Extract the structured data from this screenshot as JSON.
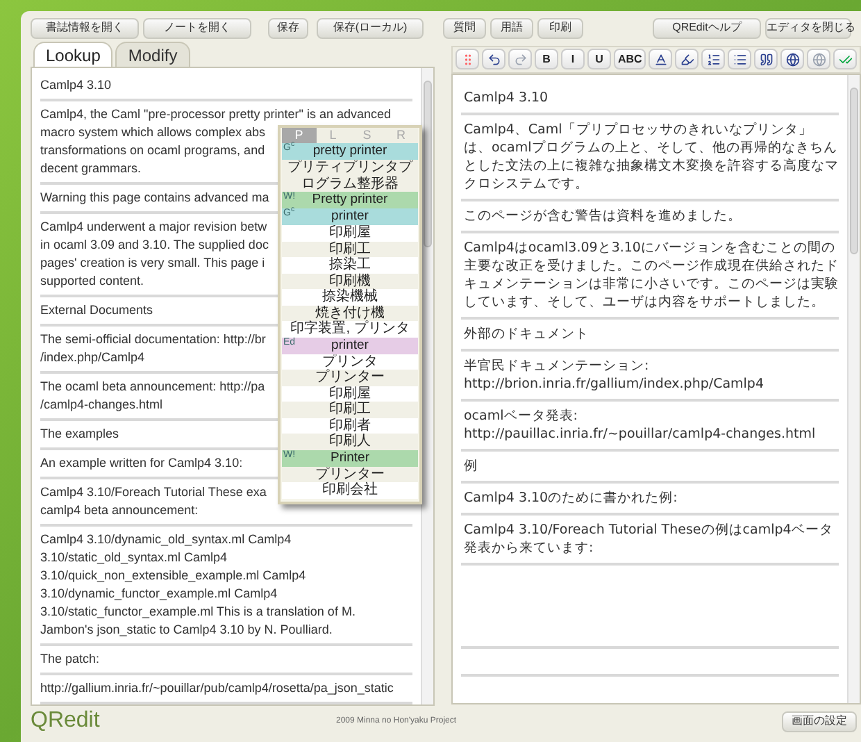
{
  "toolbar": [
    {
      "label": "書誌情報を開く"
    },
    {
      "label": "ノートを開く"
    },
    {
      "label": "保存"
    },
    {
      "label": "保存(ローカル)"
    },
    {
      "label": "質問"
    },
    {
      "label": "用語"
    },
    {
      "label": "印刷"
    },
    {
      "label": "QREditヘルプ"
    },
    {
      "label": "エディタを閉じる"
    }
  ],
  "left_panel": {
    "tabs": [
      {
        "label": "Lookup",
        "selected": true
      },
      {
        "label": "Modify",
        "selected": false
      }
    ],
    "paragraphs": [
      {
        "lines": [
          "Camlp4 3.10"
        ]
      },
      {
        "lines": [
          "Camlp4, the Caml \"pre-processor pretty printer\" is an advanced",
          "macro system which allows complex abs",
          "transformations on ocaml programs, and",
          "decent grammars."
        ]
      },
      {
        "lines": [
          "Warning this page contains advanced ma"
        ]
      },
      {
        "lines": [
          "Camlp4 underwent a major revision betw",
          "in ocaml 3.09 and 3.10. The supplied doc",
          "pages' creation is very small. This page i",
          "supported content."
        ]
      },
      {
        "lines": [
          "External Documents"
        ]
      },
      {
        "lines": [
          "The semi-official documentation: http://br",
          "/index.php/Camlp4"
        ]
      },
      {
        "lines": [
          "The ocaml beta announcement: http://pa",
          "/camlp4-changes.html"
        ]
      },
      {
        "lines": [
          "The examples"
        ]
      },
      {
        "lines": [
          "An example written for Camlp4 3.10:"
        ]
      },
      {
        "lines": [
          "Camlp4 3.10/Foreach Tutorial These exa",
          "camlp4 beta announcement:"
        ]
      },
      {
        "lines": [
          "Camlp4 3.10/dynamic_old_syntax.ml Camlp4",
          "3.10/static_old_syntax.ml Camlp4",
          "3.10/quick_non_extensible_example.ml Camlp4",
          "3.10/dynamic_functor_example.ml Camlp4",
          "3.10/static_functor_example.ml This is a translation of M.",
          "Jambon's json_static to Camlp4 3.10 by N. Poulliard."
        ]
      },
      {
        "lines": [
          "The patch:"
        ]
      },
      {
        "lines": [
          "http://gallium.inria.fr/~pouillar/pub/camlp4/rosetta/pa_json_static"
        ]
      }
    ],
    "popup": {
      "tabs": [
        {
          "label": "P",
          "selected": true
        },
        {
          "label": "L",
          "selected": false
        },
        {
          "label": "S",
          "selected": false
        },
        {
          "label": "R",
          "selected": false
        }
      ],
      "rows": [
        {
          "kind": "header",
          "source": "G$^{c}$",
          "text": "pretty printer",
          "color": "#a9dcdc"
        },
        {
          "kind": "entry",
          "text": "プリティプリンタプログラム整形器"
        },
        {
          "kind": "header",
          "source": "W!",
          "text": "Pretty printer",
          "color": "#acd9ac"
        },
        {
          "kind": "header",
          "source": "G$^{c}$",
          "text": "printer",
          "color": "#a9dcdc"
        },
        {
          "kind": "entry",
          "text": "印刷屋"
        },
        {
          "kind": "entry",
          "text": "印刷工"
        },
        {
          "kind": "entry",
          "text": "捺染工"
        },
        {
          "kind": "entry",
          "text": "印刷機"
        },
        {
          "kind": "entry",
          "text": "捺染機械"
        },
        {
          "kind": "entry",
          "text": "焼き付け機"
        },
        {
          "kind": "entry",
          "text": "印字装置, プリンタ"
        },
        {
          "kind": "header",
          "source": "Ed",
          "text": "printer",
          "color": "#e6cce6"
        },
        {
          "kind": "entry",
          "text": "プリンタ"
        },
        {
          "kind": "entry",
          "text": "プリンター"
        },
        {
          "kind": "entry",
          "text": "印刷屋"
        },
        {
          "kind": "entry",
          "text": "印刷工"
        },
        {
          "kind": "entry",
          "text": "印刷者"
        },
        {
          "kind": "entry",
          "text": "印刷人"
        },
        {
          "kind": "header",
          "source": "W!",
          "text": "Printer",
          "color": "#acd9ac"
        },
        {
          "kind": "entry",
          "text": "プリンター"
        },
        {
          "kind": "entry",
          "text": "印刷会社"
        }
      ]
    }
  },
  "editor": {
    "tools": [
      {
        "kind": "handle",
        "disabled": false
      },
      {
        "kind": "undo",
        "disabled": false
      },
      {
        "kind": "redo",
        "disabled": true
      },
      {
        "kind": "text",
        "label": "B",
        "disabled": false
      },
      {
        "kind": "text",
        "label": "I",
        "disabled": false
      },
      {
        "kind": "text",
        "label": "U",
        "disabled": false
      },
      {
        "kind": "text",
        "label": "ABC",
        "disabled": false
      },
      {
        "kind": "textcolor",
        "disabled": false
      },
      {
        "kind": "highlight",
        "disabled": false
      },
      {
        "kind": "olist",
        "disabled": false
      },
      {
        "kind": "ulist",
        "disabled": false
      },
      {
        "kind": "quote",
        "disabled": false
      },
      {
        "kind": "globe",
        "disabled": false
      },
      {
        "kind": "globe",
        "disabled": true
      },
      {
        "kind": "spell",
        "disabled": false
      }
    ],
    "paragraphs": [
      "Camlp4 3.10",
      "Camlp4、Caml「プリプロセッサのきれいなプリンタ」は、ocamlプログラムの上と、そして、他の再帰的なきちんとした文法の上に複雑な抽象構文木変換を許容する高度なマクロシステムです。",
      "このページが含む警告は資料を進めました。",
      "Camlp4はocaml3.09と3.10にバージョンを含むことの間の主要な改正を受けました。このページ作成現在供給されたドキュメンテーションは非常に小さいです。このページは実験しています、そして、ユーザは内容をサポートしました。",
      "外部のドキュメント",
      "半官民ドキュメンテーション: http://brion.inria.fr/gallium/index.php/Camlp4",
      "ocamlベータ発表: http://pauillac.inria.fr/~pouillar/camlp4-changes.html",
      "例",
      "Camlp4 3.10のために書かれた例:",
      "Camlp4 3.10/Foreach Tutorial Theseの例はcamlp4ベータ発表から来ています:"
    ]
  },
  "footer": {
    "logo": "QRedit",
    "copyright": "2009 Minna no Hon'yaku Project",
    "button": "画面の設定"
  }
}
